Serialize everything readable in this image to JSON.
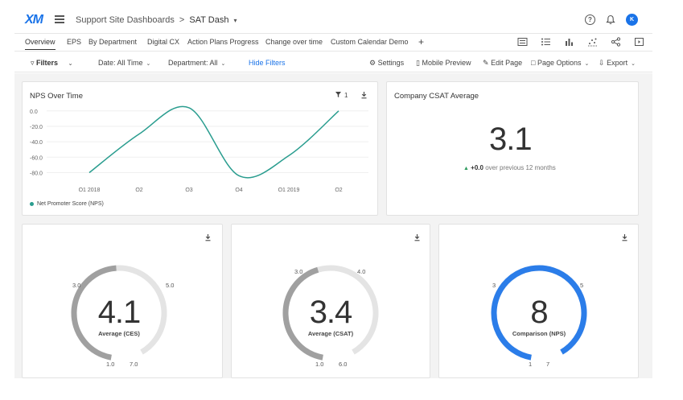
{
  "app": {
    "logo": "XM",
    "breadcrumb_root": "Support Site Dashboards",
    "breadcrumb_sep": ">",
    "breadcrumb_current": "SAT Dash",
    "avatar_initial": "K",
    "accent": "#1a73e8"
  },
  "tabs": [
    "Overview",
    "EPS",
    "By Department",
    "Digital CX",
    "Action Plans Progress",
    "Change over time",
    "Custom Calendar Demo"
  ],
  "tab_plus": "+",
  "filterbar": {
    "filters": "Filters",
    "date": "Date: All Time",
    "department": "Department:  All",
    "hide_filters": "Hide Filters",
    "settings": "Settings",
    "mobile_preview": "Mobile Preview",
    "edit_page": "Edit Page",
    "page_options": "Page Options",
    "export": "Export"
  },
  "nps_card": {
    "title": "NPS Over Time",
    "filter_count": "1",
    "legend": "Net Promoter Score (NPS)",
    "line_color": "#2a9d8f"
  },
  "chart_data": {
    "type": "line",
    "title": "NPS Over Time",
    "categories": [
      "Q1 2018",
      "Q2",
      "Q3",
      "Q4",
      "Q1 2019",
      "Q2"
    ],
    "series": [
      {
        "name": "Net Promoter Score (NPS)",
        "values": [
          -80,
          -30,
          4,
          -84,
          -58,
          0
        ]
      }
    ],
    "yticks": [
      "0.0",
      "-20.0",
      "-40.0",
      "-60.0",
      "-80.0"
    ],
    "ylim": [
      -92,
      6
    ],
    "legend_position": "bottom-left",
    "grid": true
  },
  "csat_card": {
    "title": "Company CSAT Average",
    "value": "3.1",
    "delta_value": "+0.0",
    "delta_text": "over previous 12 months"
  },
  "gauges": [
    {
      "value": "4.1",
      "label": "Average (CES)",
      "min": "1.0",
      "max": "7.0",
      "left_mark": "3.0",
      "right_mark": "5.0",
      "fraction": 0.52,
      "color": "#a0a0a0"
    },
    {
      "value": "3.4",
      "label": "Average (CSAT)",
      "min": "1.0",
      "max": "6.0",
      "left_mark": "3.0",
      "right_mark": "4.0",
      "fraction": 0.48,
      "color": "#a0a0a0"
    },
    {
      "value": "8",
      "label": "Comparison (NPS)",
      "min": "1",
      "max": "7",
      "left_mark": "3",
      "right_mark": "5",
      "fraction": 1.0,
      "color": "#2b7de9"
    }
  ]
}
